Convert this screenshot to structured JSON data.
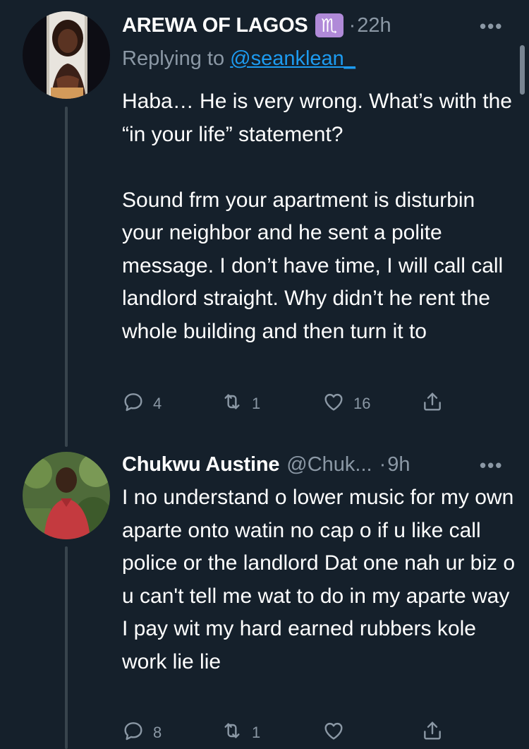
{
  "tweets": [
    {
      "name": "AREWA OF LAGOS",
      "badge": "♏",
      "dot": "·",
      "time": "22h",
      "more": "•••",
      "replying_prefix": "Replying to ",
      "replying_handle": "@seanklean_",
      "text": "Haba… He is very wrong. What’s with the “in your life” statement?\n\nSound frm your apartment is disturbin your neighbor and he sent a polite message. I don’t have time, I will call call landlord straight. Why didn’t he rent the whole building and then turn it to",
      "replies": "4",
      "retweets": "1",
      "likes": "16"
    },
    {
      "name": "Chukwu Austine",
      "handle": "@Chuk...",
      "dot": "·",
      "time": "9h",
      "more": "•••",
      "text": "I no understand o lower music for my own aparte onto watin no cap o if u like call police or the landlord Dat one nah ur biz o u can't tell me wat to do in my aparte way I pay wit my hard earned rubbers kole work lie lie",
      "replies": "8",
      "retweets": "1",
      "likes": ""
    }
  ],
  "icons": {
    "reply": "reply-icon",
    "retweet": "retweet-icon",
    "like": "heart-icon",
    "share": "share-icon",
    "more": "more-icon"
  },
  "colors": {
    "background": "#15202b",
    "secondary_text": "#8b98a5",
    "link": "#1d9bf0",
    "badge": "#b08ad8"
  }
}
